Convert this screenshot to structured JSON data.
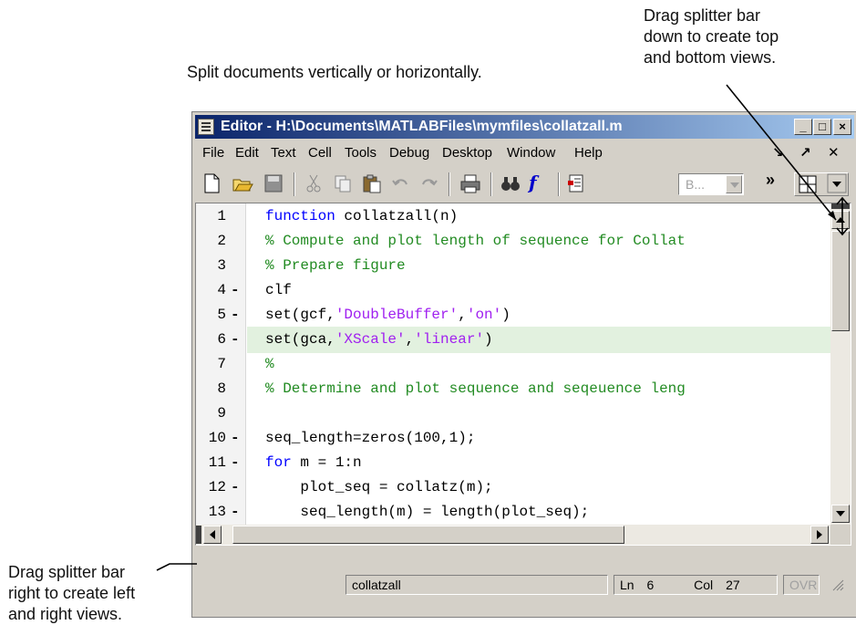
{
  "callouts": {
    "top": "Split documents vertically or horizontally.",
    "right": [
      "Drag splitter bar",
      "down to create top",
      "and bottom views."
    ],
    "left": [
      "Drag splitter bar",
      "right to create left",
      "and right views."
    ]
  },
  "window": {
    "title": "Editor - H:\\Documents\\MATLABFiles\\mymfiles\\collatzall.m",
    "controls": {
      "minimize": "_",
      "maximize": "□",
      "close": "×"
    }
  },
  "menu": [
    "File",
    "Edit",
    "Text",
    "Cell",
    "Tools",
    "Debug",
    "Desktop",
    "Window",
    "Help"
  ],
  "toolbar": {
    "icons": [
      "new-file-icon",
      "open-folder-icon",
      "save-icon",
      "cut-icon",
      "copy-icon",
      "paste-icon",
      "undo-icon",
      "redo-icon",
      "print-icon",
      "find-icon",
      "function-icon",
      "stack-icon",
      "split-icon"
    ],
    "function_label": "f",
    "cell_select_value": "B...",
    "overflow": "»"
  },
  "code_lines": [
    {
      "n": "1",
      "dash": false,
      "hl": false,
      "segments": [
        {
          "t": "function",
          "c": "kw"
        },
        {
          "t": " collatzall(n)",
          "c": ""
        }
      ]
    },
    {
      "n": "2",
      "dash": false,
      "hl": false,
      "segments": [
        {
          "t": "% Compute and plot length of sequence for Collat",
          "c": "cm"
        }
      ]
    },
    {
      "n": "3",
      "dash": false,
      "hl": false,
      "segments": [
        {
          "t": "% Prepare figure",
          "c": "cm"
        }
      ]
    },
    {
      "n": "4",
      "dash": true,
      "hl": false,
      "segments": [
        {
          "t": "clf",
          "c": ""
        }
      ]
    },
    {
      "n": "5",
      "dash": true,
      "hl": false,
      "segments": [
        {
          "t": "set(gcf,",
          "c": ""
        },
        {
          "t": "'DoubleBuffer'",
          "c": "str"
        },
        {
          "t": ",",
          "c": ""
        },
        {
          "t": "'on'",
          "c": "str"
        },
        {
          "t": ")",
          "c": ""
        }
      ]
    },
    {
      "n": "6",
      "dash": true,
      "hl": true,
      "segments": [
        {
          "t": "set(gca,",
          "c": ""
        },
        {
          "t": "'XScale'",
          "c": "str"
        },
        {
          "t": ",",
          "c": ""
        },
        {
          "t": "'linear'",
          "c": "str"
        },
        {
          "t": ")",
          "c": ""
        }
      ]
    },
    {
      "n": "7",
      "dash": false,
      "hl": false,
      "segments": [
        {
          "t": "%",
          "c": "cm"
        }
      ]
    },
    {
      "n": "8",
      "dash": false,
      "hl": false,
      "segments": [
        {
          "t": "% Determine and plot sequence and seqeuence leng",
          "c": "cm"
        }
      ]
    },
    {
      "n": "9",
      "dash": false,
      "hl": false,
      "segments": []
    },
    {
      "n": "10",
      "dash": true,
      "hl": false,
      "segments": [
        {
          "t": "seq_length=zeros(100,1);",
          "c": ""
        }
      ]
    },
    {
      "n": "11",
      "dash": true,
      "hl": false,
      "segments": [
        {
          "t": "for",
          "c": "kw"
        },
        {
          "t": " m = 1:n",
          "c": ""
        }
      ]
    },
    {
      "n": "12",
      "dash": true,
      "hl": false,
      "segments": [
        {
          "t": "    plot_seq = collatz(m);",
          "c": ""
        }
      ]
    },
    {
      "n": "13",
      "dash": true,
      "hl": false,
      "segments": [
        {
          "t": "    seq_length(m) = length(plot_seq);",
          "c": ""
        }
      ]
    }
  ],
  "status": {
    "function": "collatzall",
    "ln_label": "Ln",
    "ln_value": "6",
    "col_label": "Col",
    "col_value": "27",
    "mode": "OVR"
  },
  "colors": {
    "keyword": "#0000ff",
    "comment": "#228b22",
    "string": "#a020f0",
    "highlight": "#e2f1df",
    "titlebar": "#0a246a"
  }
}
